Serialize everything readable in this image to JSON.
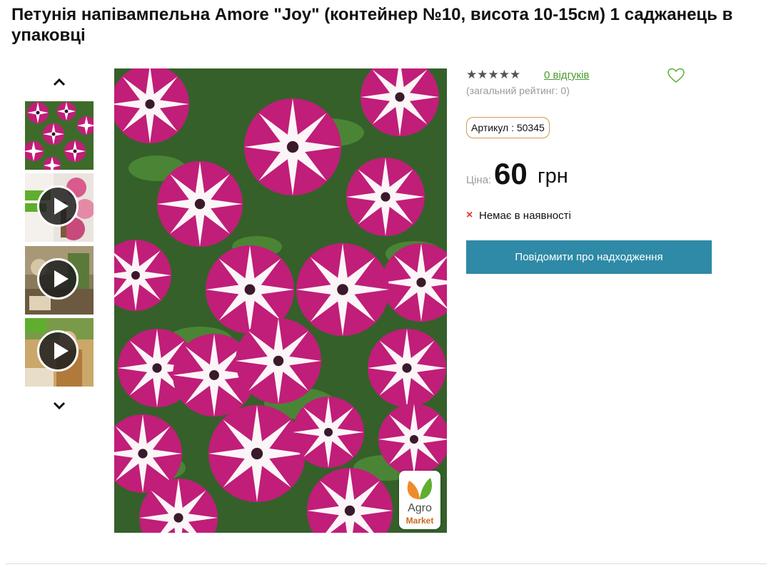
{
  "product": {
    "title": "Петунія напівампельна Amore \"Joy\" (контейнер №10, висота 10-15см) 1 саджанець в упаковці",
    "rating_stars": "★★★★★",
    "reviews_link": "0 відгуків",
    "rating_note": "(загальний рейтинг: 0)",
    "sku": "Артикул : 50345",
    "price_label": "Ціна:",
    "price_value": "60",
    "price_currency": "грн",
    "stock_status": "Немає в наявності",
    "stock_icon": "×",
    "notify_button": "Повідомити про надходження"
  },
  "gallery": {
    "up_icon": "chevron-up-icon",
    "down_icon": "chevron-down-icon",
    "thumbnails": [
      {
        "type": "image"
      },
      {
        "type": "video"
      },
      {
        "type": "video"
      },
      {
        "type": "video"
      }
    ]
  },
  "logo": {
    "agro": "Agro",
    "market": "Market"
  },
  "colors": {
    "accent_button": "#2e8aa6",
    "link_green": "#4a9c2e",
    "out_of_stock_red": "#e23a2a",
    "sku_border": "#d39a54",
    "flower_magenta": "#c01e78"
  }
}
